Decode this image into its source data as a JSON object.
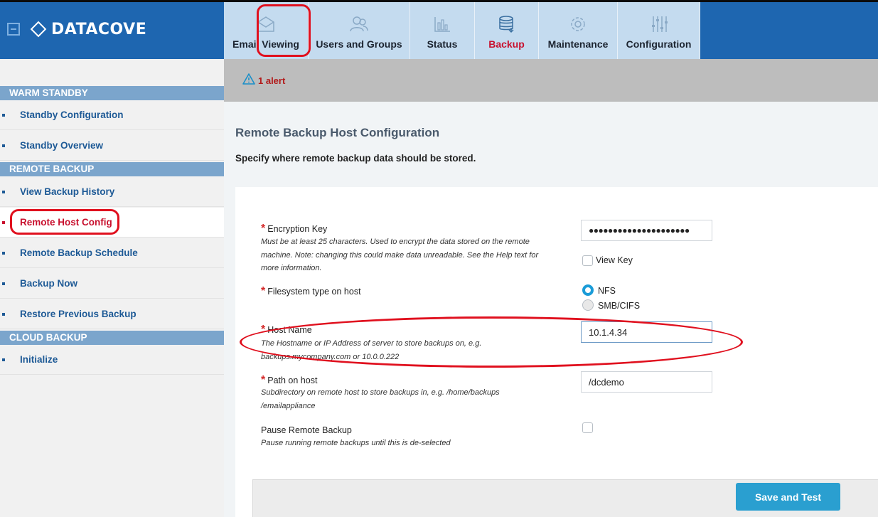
{
  "app": {
    "brand": "DATACOVE"
  },
  "tabs": [
    {
      "label": "Email Viewing",
      "icon": "envelope-icon"
    },
    {
      "label": "Users and Groups",
      "icon": "users-icon"
    },
    {
      "label": "Status",
      "icon": "bar-chart-icon"
    },
    {
      "label": "Backup",
      "icon": "database-icon",
      "active": true
    },
    {
      "label": "Maintenance",
      "icon": "gear-icon"
    },
    {
      "label": "Configuration",
      "icon": "sliders-icon"
    }
  ],
  "sidebar": {
    "sections": [
      {
        "title": "WARM STANDBY",
        "items": [
          "Standby Configuration",
          "Standby Overview"
        ]
      },
      {
        "title": "REMOTE BACKUP",
        "items": [
          "View Backup History",
          "Remote Host Config",
          "Remote Backup Schedule",
          "Backup Now",
          "Restore Previous Backup"
        ]
      },
      {
        "title": "CLOUD BACKUP",
        "items": [
          "Initialize"
        ]
      }
    ],
    "active_item": "Remote Host Config"
  },
  "alert": {
    "text": "1 alert"
  },
  "main": {
    "title": "Remote Backup Host Configuration",
    "subtitle": "Specify where remote backup data should be stored.",
    "fields": {
      "encryption_key": {
        "label": "Encryption Key",
        "help_lines": [
          "Must be at least 25 characters. Used to encrypt the data stored on the remote",
          "machine. Note: changing this could make data unreadable. See the Help text for",
          "more information."
        ],
        "value": "●●●●●●●●●●●●●●●●●●●●●",
        "view_key_label": "View Key",
        "view_key_checked": false
      },
      "filesystem": {
        "label": "Filesystem type on host",
        "options": [
          "NFS",
          "SMB/CIFS"
        ],
        "selected": "NFS"
      },
      "host_name": {
        "label": "Host Name",
        "help_lines": [
          "The Hostname or IP Address of server to store backups on, e.g.",
          "backups.mycompany.com or 10.0.0.222"
        ],
        "value": "10.1.4.34"
      },
      "path": {
        "label": "Path on host",
        "help_lines": [
          "Subdirectory on remote host to store backups in, e.g. /home/backups",
          "/emailappliance"
        ],
        "value": "/dcdemo"
      },
      "pause": {
        "label": "Pause Remote Backup",
        "help": "Pause running remote backups until this is de-selected",
        "checked": false
      }
    },
    "save_label": "Save and Test"
  },
  "colors": {
    "header": "#1e66b0",
    "tab": "#c4dbef",
    "accent": "#2a9fd0",
    "highlight_ring": "#e0101e"
  }
}
